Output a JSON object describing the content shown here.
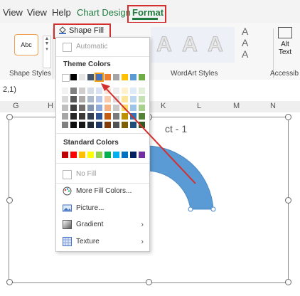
{
  "tabs": [
    {
      "label": "View"
    },
    {
      "label": "Help"
    },
    {
      "label": "Chart Design"
    },
    {
      "label": "Format"
    }
  ],
  "ribbon": {
    "shape_style_sample": "Abc",
    "shape_fill_label": "Shape Fill",
    "shape_fill_caret": "⌄",
    "shape_styles_label": "Shape Styles",
    "wordart_sample": "A",
    "wordart_styles_label": "WordArt Styles",
    "alt_text_line1": "Alt",
    "alt_text_line2": "Text",
    "accessibility_label": "Accessib"
  },
  "formula_bar": {
    "text": "2,1)"
  },
  "columns": [
    "G",
    "H",
    "K",
    "L",
    "M",
    "N"
  ],
  "chart": {
    "title_fragment": "ct - 1",
    "arc_color": "#5b9bd5"
  },
  "menu": {
    "automatic": "Automatic",
    "theme_colors_header": "Theme Colors",
    "standard_colors_header": "Standard Colors",
    "no_fill": "No Fill",
    "more_fill_colors": "More Fill Colors...",
    "picture": "Picture...",
    "gradient": "Gradient",
    "texture": "Texture",
    "submenu_arrow": "›"
  },
  "theme_colors_top": [
    "#ffffff",
    "#000000",
    "#e7e6e6",
    "#44546a",
    "#4472c4",
    "#ed7d31",
    "#a5a5a5",
    "#ffc000",
    "#5b9bd5",
    "#70ad47"
  ],
  "theme_shades": [
    [
      "#f2f2f2",
      "#808080",
      "#d0cece",
      "#d6dce4",
      "#d9e2f3",
      "#fbe4d5",
      "#ededed",
      "#fff2cc",
      "#deebf6",
      "#e2efd9"
    ],
    [
      "#d9d9d9",
      "#595959",
      "#aeaaaa",
      "#adb9ca",
      "#b4c6e7",
      "#f7cbac",
      "#dbdbdb",
      "#fee599",
      "#bdd7ee",
      "#c5e0b3"
    ],
    [
      "#bfbfbf",
      "#404040",
      "#757070",
      "#8496b0",
      "#8eaadb",
      "#f4b183",
      "#c9c9c9",
      "#ffd966",
      "#9dc3e6",
      "#a8d08d"
    ],
    [
      "#a6a6a6",
      "#262626",
      "#3b3838",
      "#323f4f",
      "#2f5496",
      "#c55a11",
      "#7b7b7b",
      "#bf9000",
      "#2e75b5",
      "#538135"
    ],
    [
      "#808080",
      "#0d0d0d",
      "#161616",
      "#212934",
      "#1f3864",
      "#823b0b",
      "#525252",
      "#7f6000",
      "#1f4e79",
      "#375623"
    ]
  ],
  "standard_colors": [
    "#c00000",
    "#ff0000",
    "#ffc000",
    "#ffff00",
    "#92d050",
    "#00b050",
    "#00b0f0",
    "#0070c0",
    "#002060",
    "#7030a0"
  ],
  "annotation": {
    "color": "#d32f2f"
  }
}
